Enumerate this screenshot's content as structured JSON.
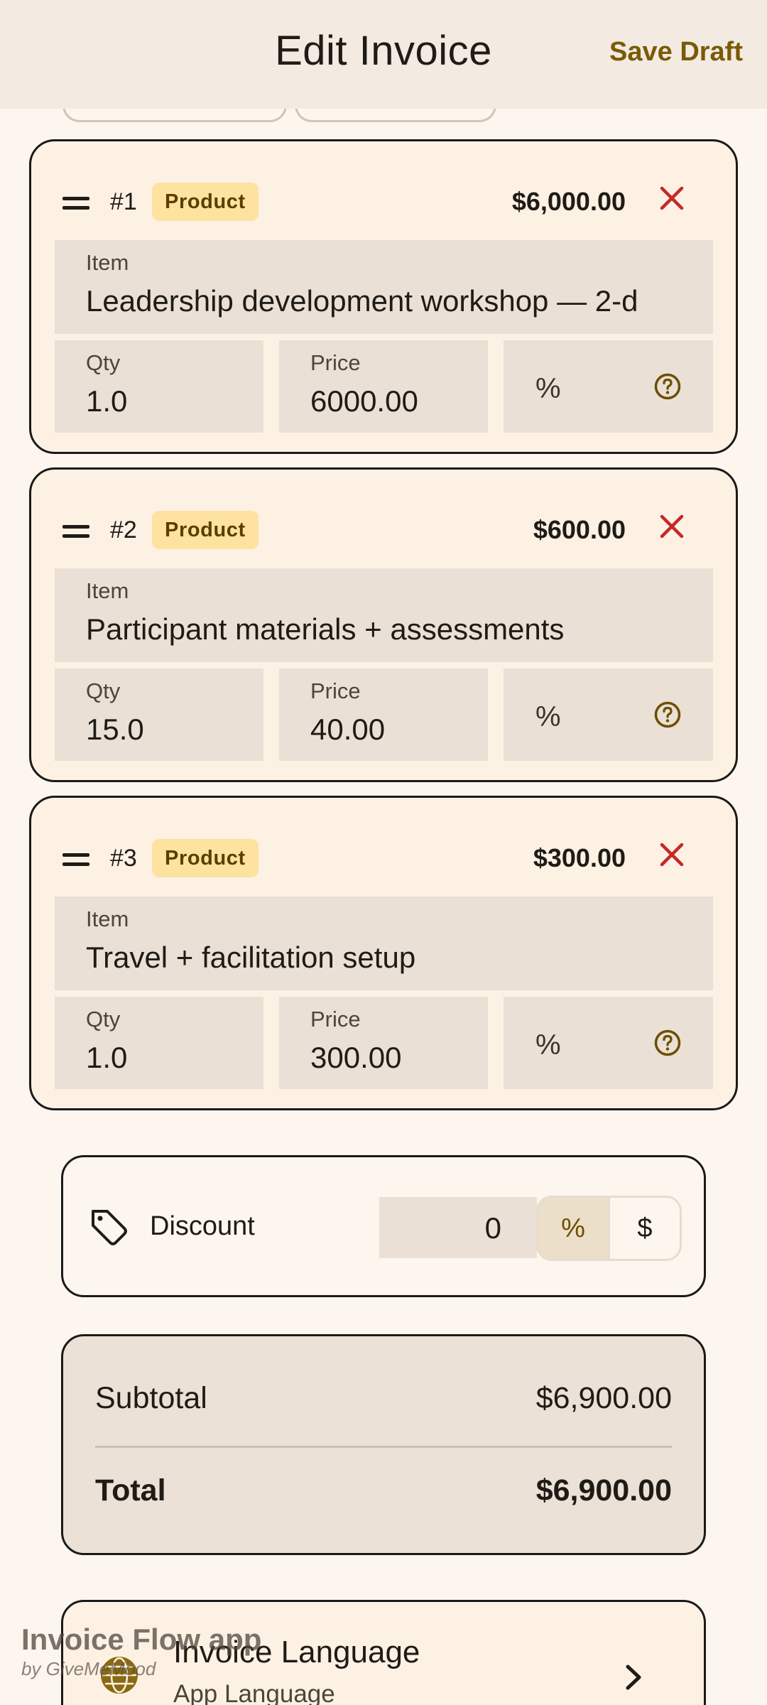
{
  "header": {
    "title": "Edit Invoice",
    "save_label": "Save Draft"
  },
  "items": [
    {
      "number": "#1",
      "type": "Product",
      "amount": "$6,000.00",
      "item_label": "Item",
      "item_value": "Leadership development workshop — 2-d",
      "qty_label": "Qty",
      "qty": "1.0",
      "price_label": "Price",
      "price": "6000.00",
      "percent": "%"
    },
    {
      "number": "#2",
      "type": "Product",
      "amount": "$600.00",
      "item_label": "Item",
      "item_value": "Participant materials + assessments",
      "qty_label": "Qty",
      "qty": "15.0",
      "price_label": "Price",
      "price": "40.00",
      "percent": "%"
    },
    {
      "number": "#3",
      "type": "Product",
      "amount": "$300.00",
      "item_label": "Item",
      "item_value": "Travel + facilitation setup",
      "qty_label": "Qty",
      "qty": "1.0",
      "price_label": "Price",
      "price": "300.00",
      "percent": "%"
    }
  ],
  "discount": {
    "label": "Discount",
    "value": "0",
    "toggle_percent": "%",
    "toggle_dollar": "$",
    "selected": "%"
  },
  "totals": {
    "subtotal_label": "Subtotal",
    "subtotal": "$6,900.00",
    "total_label": "Total",
    "total": "$6,900.00"
  },
  "language": {
    "title": "Invoice Language",
    "subtitle": "App Language"
  },
  "watermark": {
    "name": "Invoice Flow app",
    "by": "by GiveMeMood"
  },
  "colors": {
    "accent": "#7a5a06",
    "badge_bg": "#fde2a0",
    "remove": "#c62828",
    "card_bg": "#fdf1e4",
    "field_bg": "#eae0d5"
  },
  "icons": {
    "drag": "drag-handle-icon",
    "remove": "close-icon",
    "help": "help-circle-icon",
    "tag": "tag-icon",
    "globe": "globe-icon",
    "chevron": "chevron-right-icon"
  }
}
